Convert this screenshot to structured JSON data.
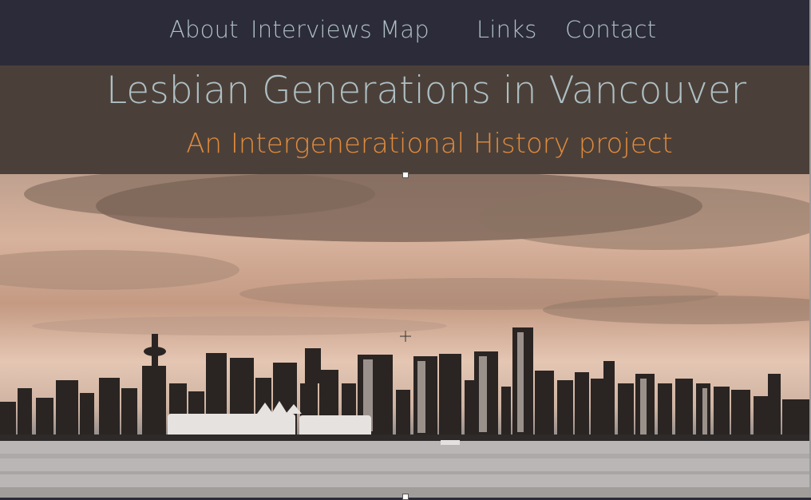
{
  "nav": {
    "items": [
      {
        "label": "About"
      },
      {
        "label": "Interviews"
      },
      {
        "label": "Map"
      },
      {
        "label": "Links"
      },
      {
        "label": "Contact"
      }
    ]
  },
  "header": {
    "title": "Lesbian Generations in Vancouver",
    "subtitle": "An Intergenerational History project"
  },
  "colors": {
    "nav_bg": "#2c2b39",
    "banner_bg": "#4b4039",
    "title_color": "#aebfc4",
    "subtitle_color": "#e08a3c"
  },
  "hero": {
    "image": "vancouver-skyline-sepia"
  }
}
